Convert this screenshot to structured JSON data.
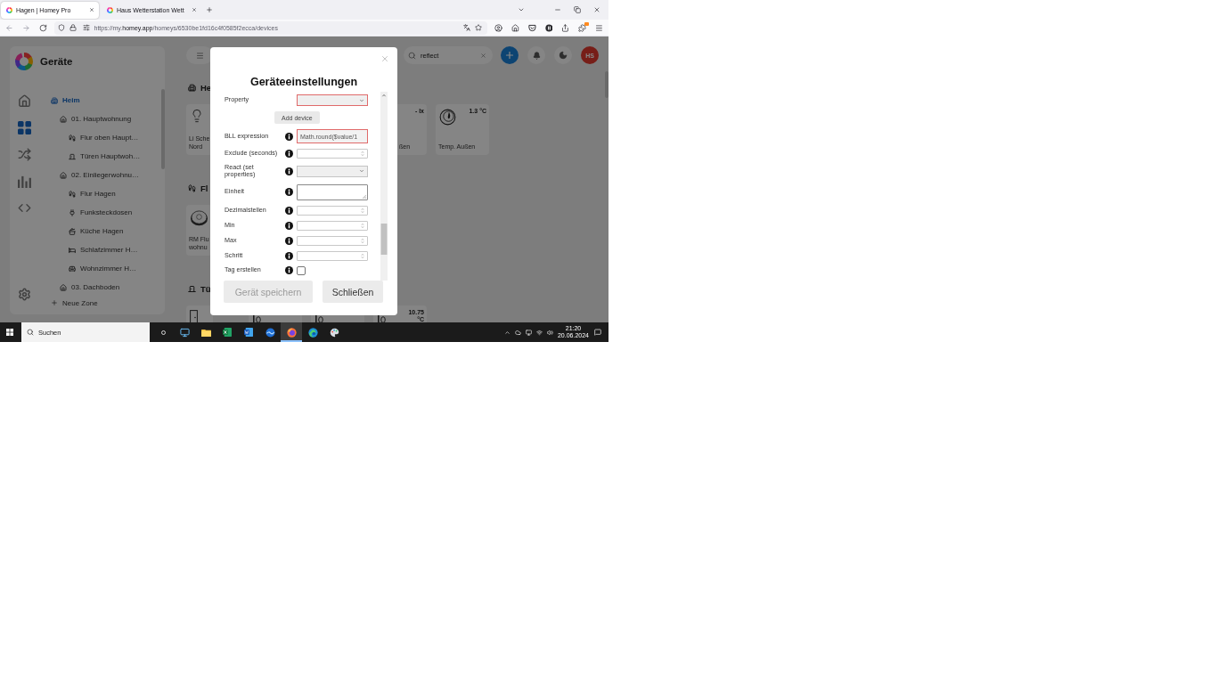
{
  "browser": {
    "tabs": [
      {
        "title": "Hagen | Homey Pro",
        "selected": true
      },
      {
        "title": "Haus Wetterstation Wett",
        "selected": false
      }
    ],
    "address": {
      "start": "https://my.",
      "domain": "homey.app",
      "path": "/homeys/6530be1fd16c4f0585f2ecca/devices"
    }
  },
  "sidebar": {
    "title": "Geräte",
    "nav": [
      {
        "kind": "home",
        "selected": false
      },
      {
        "kind": "devices",
        "selected": true
      },
      {
        "kind": "flows",
        "selected": false
      },
      {
        "kind": "insights",
        "selected": false
      },
      {
        "kind": "scripts",
        "selected": false
      },
      {
        "kind": "settings",
        "selected": false
      }
    ],
    "zones": [
      {
        "kind": "home",
        "label": "Heim",
        "selected": true,
        "children": [
          {
            "kind": "floor",
            "label": "01. Hauptwohnung",
            "selected": false,
            "children": [
              {
                "kind": "hallway",
                "label": "Flur oben Haupt…",
                "selected": false
              },
              {
                "kind": "door",
                "label": "Türen Hauptwoh…",
                "selected": false
              }
            ]
          },
          {
            "kind": "floor",
            "label": "02. Einliegerwohnu…",
            "selected": false,
            "children": [
              {
                "kind": "hallway",
                "label": "Flur Hagen",
                "selected": false
              },
              {
                "kind": "socket",
                "label": "Funksteckdosen",
                "selected": false
              },
              {
                "kind": "kitchen",
                "label": "Küche Hagen",
                "selected": false
              },
              {
                "kind": "bedroom",
                "label": "Schlafzimmer H…",
                "selected": false
              },
              {
                "kind": "livingroom",
                "label": "Wohnzimmer H…",
                "selected": false
              }
            ]
          },
          {
            "kind": "floor",
            "label": "03. Dachboden",
            "selected": false
          }
        ]
      }
    ],
    "add_zone": "Neue Zone"
  },
  "header": {
    "search": {
      "value": "reflect"
    },
    "avatar": "HS"
  },
  "sections": [
    {
      "kind": "home",
      "title": "He",
      "cards": [
        {
          "kind": "bulb",
          "name_lines": [
            "Li Sche",
            "Nord"
          ],
          "left_hidden": false,
          "right_hidden": true
        },
        {
          "value": "- lx",
          "name_lines": [
            "ßen"
          ],
          "left_hidden": true,
          "right_hidden": false
        },
        {
          "kind": "climate",
          "value": "1.3 °C",
          "name_lines": [
            "Temp. Außen"
          ],
          "left_hidden": false,
          "right_hidden": false
        }
      ]
    },
    {
      "kind": "hallway",
      "title": "Fl",
      "cards": [
        {
          "kind": "vacuum",
          "name_lines": [
            "RM Flu",
            "wohnu"
          ],
          "left_hidden": false,
          "right_hidden": true
        }
      ]
    },
    {
      "kind": "door",
      "title": "Tü",
      "cards": [
        {
          "kind": "door",
          "left_hidden": false,
          "right_hidden": true
        },
        {
          "kind": "contact",
          "left_hidden": false,
          "right_hidden": false
        },
        {
          "kind": "contact",
          "left_hidden": false,
          "right_hidden": false
        },
        {
          "kind": "contact",
          "value": "10.75 °C",
          "left_hidden": false,
          "right_hidden": false
        }
      ]
    }
  ],
  "dialog": {
    "title": "Geräteeinstellungen",
    "fields": [
      {
        "kind": "select",
        "label": "Property",
        "info": false,
        "invalid": true
      },
      {
        "kind": "button",
        "label": "Add device"
      },
      {
        "kind": "text",
        "label": "BLL expression",
        "info": true,
        "invalid": true,
        "value": "Math.round($value/1"
      },
      {
        "kind": "number",
        "label": "Exclude (seconds)",
        "info": true,
        "invalid": false
      },
      {
        "kind": "select",
        "label": "React (set properties)",
        "info": true,
        "invalid": false
      },
      {
        "kind": "textarea",
        "label": "Einheit",
        "info": true,
        "invalid": false
      },
      {
        "kind": "number",
        "label": "Dezimalstellen",
        "info": true,
        "invalid": false
      },
      {
        "kind": "number",
        "label": "Min",
        "info": true,
        "invalid": false
      },
      {
        "kind": "number",
        "label": "Max",
        "info": true,
        "invalid": false
      },
      {
        "kind": "number",
        "label": "Schritt",
        "info": true,
        "invalid": false
      },
      {
        "kind": "checkbox",
        "label": "Tag erstellen",
        "info": true,
        "checked": false
      }
    ],
    "buttons": [
      {
        "label": "Gerät speichern",
        "disabled": true
      },
      {
        "label": "Schließen",
        "disabled": false
      }
    ]
  },
  "taskbar": {
    "search": {
      "placeholder": "Suchen"
    },
    "apps": [
      {
        "kind": "circle",
        "selected": false
      },
      {
        "kind": "monitor",
        "selected": false
      },
      {
        "kind": "folder",
        "selected": false
      },
      {
        "kind": "spreadsheet",
        "selected": false
      },
      {
        "kind": "document",
        "selected": false
      },
      {
        "kind": "globe",
        "selected": false
      },
      {
        "kind": "firefox",
        "selected": true
      },
      {
        "kind": "edge",
        "selected": false
      },
      {
        "kind": "palette",
        "selected": false
      }
    ],
    "time": "21:20",
    "date": "20.06.2024"
  }
}
